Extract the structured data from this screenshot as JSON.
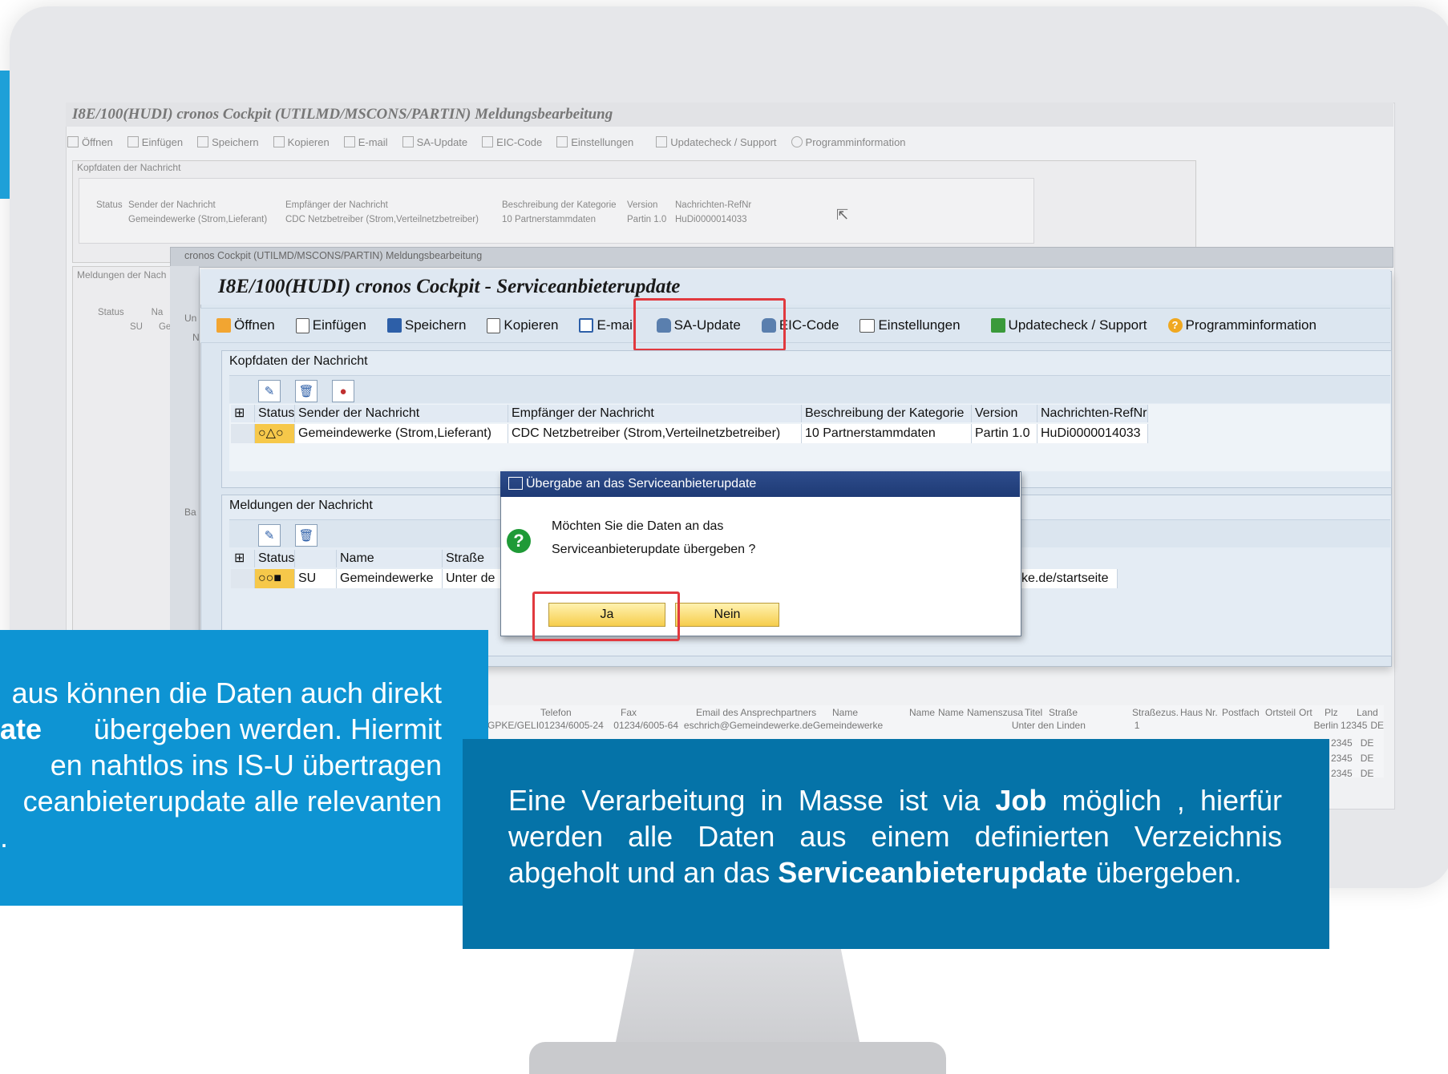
{
  "bg_window": {
    "title": "I8E/100(HUDI)  cronos Cockpit (UTILMD/MSCONS/PARTIN) Meldungsbearbeitung",
    "toolbar": [
      "Öffnen",
      "Einfügen",
      "Speichern",
      "Kopieren",
      "E-mail",
      "SA-Update",
      "EIC-Code",
      "Einstellungen",
      "Updatecheck / Support",
      "Programminformation"
    ],
    "kopf_label": "Kopfdaten der Nachricht",
    "kopf_headers": [
      "Status",
      "Sender der Nachricht",
      "Empfänger der Nachricht",
      "Beschreibung der Kategorie",
      "Version",
      "Nachrichten-RefNr"
    ],
    "kopf_row": [
      "Gemeindewerke (Strom,Lieferant)",
      "CDC Netzbetreiber (Strom,Verteilnetzbetreiber)",
      "10 Partnerstammdaten",
      "Partin 1.0",
      "HuDi0000014033"
    ],
    "meld_label": "Meldungen der Nach",
    "meld_headers": [
      "Status",
      "Na"
    ],
    "meld_row": [
      "SU",
      "Ge"
    ],
    "sub_window_title": "cronos Cockpit (UTILMD/MSCONS/PARTIN) Meldungsbearbeitung",
    "bottom_headers": [
      "Telefon",
      "Fax",
      "Email des Ansprechpartners",
      "Name",
      "Name",
      "Name",
      "Namenszusa",
      "Titel",
      "Straße",
      "Straßezus.",
      "Haus Nr.",
      "Postfach",
      "Ortsteil",
      "Ort",
      "Plz",
      "Land"
    ],
    "bottom_row": [
      "GPKE/GELI",
      "01234/6005-24",
      "01234/6005-64",
      "eschrich@Gemeindewerke.de",
      "Gemeindewerke",
      "Unter den Linden",
      "1",
      "Berlin",
      "12345",
      "DE"
    ],
    "bottom_extra_plz": [
      "2345",
      "2345",
      "2345"
    ],
    "bottom_extra_land": [
      "DE",
      "DE",
      "DE"
    ]
  },
  "main_window": {
    "title": "I8E/100(HUDI)  cronos Cockpit - Serviceanbieterupdate",
    "toolbar": [
      {
        "label": "Öffnen",
        "icon": "folder-open-icon",
        "color": "#f2a531"
      },
      {
        "label": "Einfügen",
        "icon": "insert-doc-icon",
        "color": "#ffffff"
      },
      {
        "label": "Speichern",
        "icon": "save-disk-icon",
        "color": "#2d5fa8"
      },
      {
        "label": "Kopieren",
        "icon": "copy-doc-icon",
        "color": "#ffffff"
      },
      {
        "label": "E-mail",
        "icon": "email-icon",
        "color": "#2d5fa8"
      },
      {
        "label": "SA-Update",
        "icon": "database-icon",
        "color": "#5a7fae"
      },
      {
        "label": "EIC-Code",
        "icon": "database-icon",
        "color": "#5a7fae"
      },
      {
        "label": "Einstellungen",
        "icon": "settings-list-icon",
        "color": "#ffffff"
      },
      {
        "label": "Updatecheck / Support",
        "icon": "update-icon",
        "color": "#3a9a3a"
      },
      {
        "label": "Programminformation",
        "icon": "info-icon",
        "color": "#f0a820"
      }
    ],
    "kopf": {
      "label": "Kopfdaten der Nachricht",
      "headers": [
        "Status",
        "Sender der Nachricht",
        "Empfänger der Nachricht",
        "Beschreibung der Kategorie",
        "Version",
        "Nachrichten-RefNr"
      ],
      "row": [
        "Gemeindewerke (Strom,Lieferant)",
        "CDC Netzbetreiber (Strom,Verteilnetzbetreiber)",
        "10 Partnerstammdaten",
        "Partin 1.0",
        "HuDi0000014033"
      ]
    },
    "meld": {
      "label": "Meldungen der Nachricht",
      "headers": [
        "Status",
        "",
        "Name",
        "Straße"
      ],
      "row": [
        "SU",
        "Gemeindewerke",
        "Unter de"
      ],
      "url_fragment": "ke.de/startseite"
    },
    "side_fragments": [
      "Un",
      "N",
      "Ba"
    ]
  },
  "dialog": {
    "title": "Übergabe an das Serviceanbieterupdate",
    "line1": "Möchten Sie die Daten an das",
    "line2": "Serviceanbieterupdate übergeben ?",
    "yes": "Ja",
    "no": "Nein"
  },
  "left_text": {
    "line1": "aus können die Daten auch direkt",
    "line2_bold": "ate",
    "line2_rest": " übergeben werden. Hiermit",
    "line3": "en nahtlos ins IS-U übertragen",
    "line4": "ceanbieterupdate alle relevanten",
    "line5": "."
  },
  "right_text": {
    "p1": "Eine Verarbeitung in Masse ist via ",
    "b1": "Job",
    "p2": " möglich , hierfür werden alle Daten aus einem definierten Verzeichnis abgeholt und an das ",
    "b2": "Serviceanbieterupdate",
    "p3": " übergeben."
  },
  "colors": {
    "highlight": "#e1393f",
    "left_box": "#0e94d3",
    "right_box": "#0573a8",
    "dialog_title": "#1e3a75"
  }
}
